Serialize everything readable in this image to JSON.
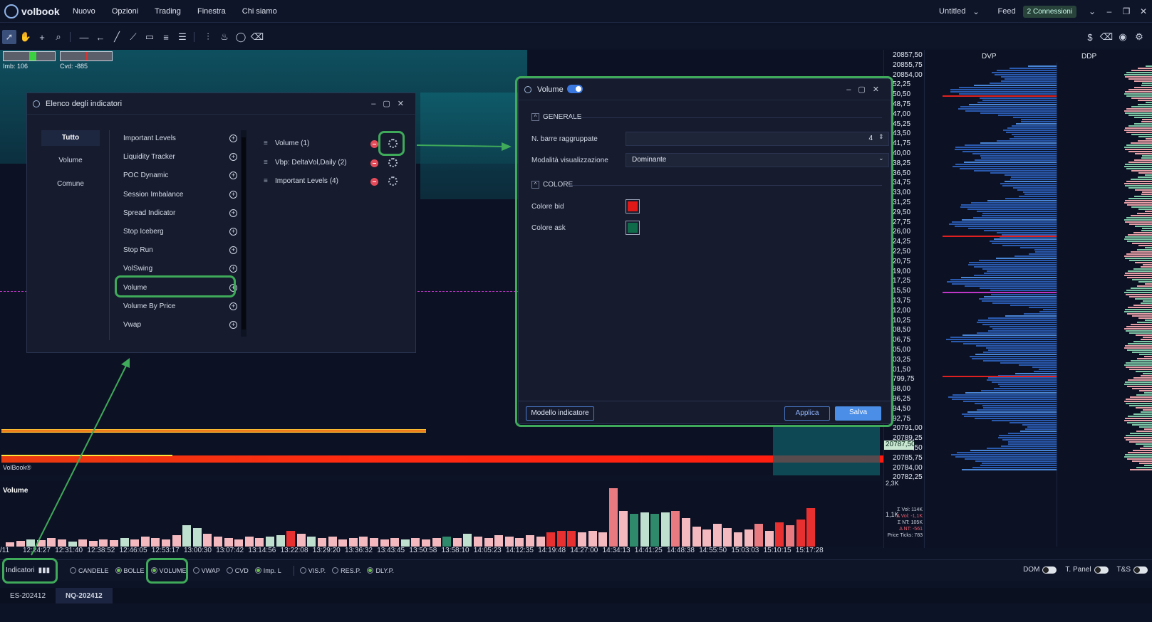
{
  "app": {
    "name": "volbook",
    "menu": [
      "Nuovo",
      "Opzioni",
      "Trading",
      "Finestra",
      "Chi siamo"
    ],
    "workspace": "Untitled",
    "feed_label": "Feed",
    "connections": "2 Connessioni"
  },
  "chart": {
    "imb": "Imb: 106",
    "cvd": "Cvd: -885",
    "watermark": "VolBook®",
    "volume_label": "Volume",
    "dvp_label": "DVP",
    "ddp_label": "DDP",
    "last_price": "20787,50",
    "volume_scale": "2,3K",
    "volume_mid": "1,1K",
    "stats": [
      "Σ Vol: 114K",
      "Δ Vol: -1,1K",
      "Σ NT: 105K",
      "Δ NT: -561",
      "Price Ticks: 783"
    ],
    "price_labels": [
      "20857,50",
      "20855,75",
      "20854,00",
      "52,25",
      "50,50",
      "48,75",
      "47,00",
      "45,25",
      "43,50",
      "41,75",
      "40,00",
      "38,25",
      "36,50",
      "34,75",
      "33,00",
      "31,25",
      "29,50",
      "27,75",
      "26,00",
      "24,25",
      "22,50",
      "20,75",
      "19,00",
      "17,25",
      "15,50",
      "13,75",
      "12,00",
      "10,25",
      "08,50",
      "06,75",
      "05,00",
      "03,25",
      "01,50",
      "799,75",
      "98,00",
      "96,25",
      "94,50",
      "92,75",
      "20791,00",
      "20789,25",
      "20787,50",
      "20785,75",
      "20784,00",
      "20782,25"
    ],
    "times": [
      "/11",
      "12:24:27",
      "12:31:40",
      "12:38:52",
      "12:46:05",
      "12:53:17",
      "13:00:30",
      "13:07:42",
      "13:14:56",
      "13:22:08",
      "13:29:20",
      "13:36:32",
      "13:43:45",
      "13:50:58",
      "13:58:10",
      "14:05:23",
      "14:12:35",
      "14:19:48",
      "14:27:00",
      "14:34:13",
      "14:41:25",
      "14:48:38",
      "14:55:50",
      "15:03:03",
      "15:10:15",
      "15:17:28"
    ],
    "volume_bars": [
      {
        "v": 6,
        "c": "#f3b9bf"
      },
      {
        "v": 8,
        "c": "#f3b9bf"
      },
      {
        "v": 10,
        "c": "#bfe0cf"
      },
      {
        "v": 9,
        "c": "#f3b9bf"
      },
      {
        "v": 12,
        "c": "#f3b9bf"
      },
      {
        "v": 10,
        "c": "#f3b9bf"
      },
      {
        "v": 7,
        "c": "#bfe0cf"
      },
      {
        "v": 10,
        "c": "#f3b9bf"
      },
      {
        "v": 8,
        "c": "#f3b9bf"
      },
      {
        "v": 10,
        "c": "#f3b9bf"
      },
      {
        "v": 9,
        "c": "#f3b9bf"
      },
      {
        "v": 12,
        "c": "#bfe0cf"
      },
      {
        "v": 10,
        "c": "#f3b9bf"
      },
      {
        "v": 14,
        "c": "#f3b9bf"
      },
      {
        "v": 12,
        "c": "#f3b9bf"
      },
      {
        "v": 10,
        "c": "#f3b9bf"
      },
      {
        "v": 16,
        "c": "#f3b9bf"
      },
      {
        "v": 30,
        "c": "#bfe0cf"
      },
      {
        "v": 26,
        "c": "#bfe0cf"
      },
      {
        "v": 18,
        "c": "#f3b9bf"
      },
      {
        "v": 14,
        "c": "#f3b9bf"
      },
      {
        "v": 12,
        "c": "#f3b9bf"
      },
      {
        "v": 10,
        "c": "#f3b9bf"
      },
      {
        "v": 14,
        "c": "#f3b9bf"
      },
      {
        "v": 12,
        "c": "#f3b9bf"
      },
      {
        "v": 14,
        "c": "#bfe0cf"
      },
      {
        "v": 16,
        "c": "#bfe0cf"
      },
      {
        "v": 22,
        "c": "#e83030"
      },
      {
        "v": 18,
        "c": "#f3b9bf"
      },
      {
        "v": 14,
        "c": "#bfe0cf"
      },
      {
        "v": 12,
        "c": "#f3b9bf"
      },
      {
        "v": 14,
        "c": "#f3b9bf"
      },
      {
        "v": 10,
        "c": "#f3b9bf"
      },
      {
        "v": 12,
        "c": "#f3b9bf"
      },
      {
        "v": 14,
        "c": "#f3b9bf"
      },
      {
        "v": 12,
        "c": "#f3b9bf"
      },
      {
        "v": 10,
        "c": "#f3b9bf"
      },
      {
        "v": 12,
        "c": "#f3b9bf"
      },
      {
        "v": 10,
        "c": "#bfe0cf"
      },
      {
        "v": 12,
        "c": "#f3b9bf"
      },
      {
        "v": 10,
        "c": "#f3b9bf"
      },
      {
        "v": 12,
        "c": "#f3b9bf"
      },
      {
        "v": 14,
        "c": "#2e8a6a"
      },
      {
        "v": 12,
        "c": "#f3b9bf"
      },
      {
        "v": 18,
        "c": "#bfe0cf"
      },
      {
        "v": 14,
        "c": "#f3b9bf"
      },
      {
        "v": 12,
        "c": "#f3b9bf"
      },
      {
        "v": 16,
        "c": "#f3b9bf"
      },
      {
        "v": 14,
        "c": "#f3b9bf"
      },
      {
        "v": 12,
        "c": "#f3b9bf"
      },
      {
        "v": 16,
        "c": "#f3b9bf"
      },
      {
        "v": 14,
        "c": "#f3b9bf"
      },
      {
        "v": 20,
        "c": "#e83030"
      },
      {
        "v": 22,
        "c": "#e83030"
      },
      {
        "v": 22,
        "c": "#e83030"
      },
      {
        "v": 20,
        "c": "#f3b9bf"
      },
      {
        "v": 22,
        "c": "#f3b9bf"
      },
      {
        "v": 20,
        "c": "#f3b9bf"
      },
      {
        "v": 82,
        "c": "#e87a80"
      },
      {
        "v": 50,
        "c": "#f3b9bf"
      },
      {
        "v": 46,
        "c": "#2e8a6a"
      },
      {
        "v": 48,
        "c": "#bfe0cf"
      },
      {
        "v": 46,
        "c": "#2e8a6a"
      },
      {
        "v": 48,
        "c": "#bfe0cf"
      },
      {
        "v": 50,
        "c": "#e87a80"
      },
      {
        "v": 40,
        "c": "#f3b9bf"
      },
      {
        "v": 28,
        "c": "#f3b9bf"
      },
      {
        "v": 24,
        "c": "#f3b9bf"
      },
      {
        "v": 32,
        "c": "#f3b9bf"
      },
      {
        "v": 26,
        "c": "#f3b9bf"
      },
      {
        "v": 20,
        "c": "#f3b9bf"
      },
      {
        "v": 24,
        "c": "#f3b9bf"
      },
      {
        "v": 32,
        "c": "#e87a80"
      },
      {
        "v": 22,
        "c": "#f3b9bf"
      },
      {
        "v": 34,
        "c": "#e83030"
      },
      {
        "v": 30,
        "c": "#e87a80"
      },
      {
        "v": 38,
        "c": "#e83030"
      },
      {
        "v": 54,
        "c": "#e83030"
      }
    ]
  },
  "indicator_list": {
    "title": "Elenco degli indicatori",
    "categories": [
      "Tutto",
      "Volume",
      "Comune"
    ],
    "items": [
      "Important Levels",
      "Liquidity Tracker",
      "POC Dynamic",
      "Session Imbalance",
      "Spread Indicator",
      "Stop Iceberg",
      "Stop Run",
      "VolSwing",
      "Volume",
      "Volume By Price",
      "Vwap"
    ],
    "active": [
      "Volume (1)",
      "Vbp: DeltaVol,Daily (2)",
      "Important Levels (4)"
    ]
  },
  "volume_dialog": {
    "title": "Volume",
    "section_general": "GENERALE",
    "label_group": "N. barre raggruppate",
    "group_value": "4",
    "label_mode": "Modalità visualizzazione",
    "mode_value": "Dominante",
    "section_color": "COLORE",
    "label_bid": "Colore bid",
    "label_ask": "Colore ask",
    "bid_color": "#e01818",
    "ask_color": "#0f6b4a",
    "btn_template": "Modello indicatore",
    "btn_apply": "Applica",
    "btn_save": "Salva"
  },
  "bottombar": {
    "indicators_btn": "Indicatori",
    "toggles": [
      {
        "label": "CANDELE",
        "on": false
      },
      {
        "label": "BOLLE",
        "on": true
      },
      {
        "label": "VOLUME",
        "on": true
      },
      {
        "label": "VWAP",
        "on": false
      },
      {
        "label": "CVD",
        "on": false
      },
      {
        "label": "Imp. L",
        "on": true
      }
    ],
    "toggles2": [
      {
        "label": "VIS.P.",
        "on": false
      },
      {
        "label": "RES.P.",
        "on": false
      },
      {
        "label": "DLY.P.",
        "on": true
      }
    ],
    "switches": [
      "DOM",
      "T. Panel",
      "T&S"
    ]
  },
  "tabs": [
    "ES-202412",
    "NQ-202412"
  ]
}
